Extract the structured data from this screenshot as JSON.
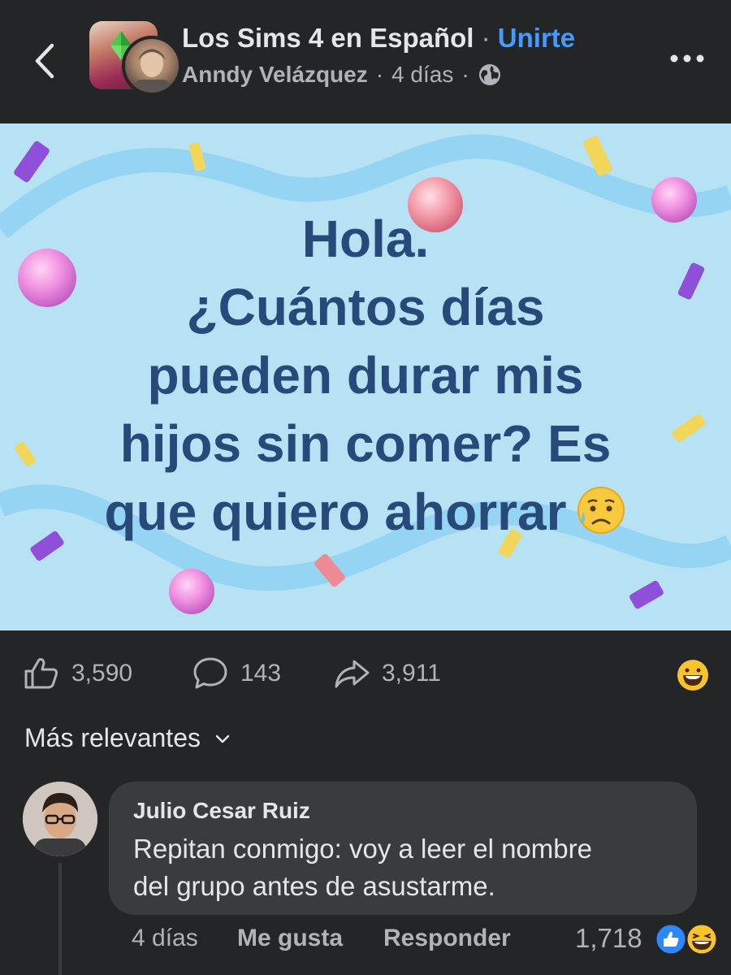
{
  "header": {
    "group_name": "Los Sims 4 en Español",
    "separator": "·",
    "join_label": "Unirte",
    "author": "Anndy Velázquez",
    "sub_separator_1": "·",
    "time": "4 días",
    "sub_separator_2": "·",
    "back_icon": "chevron-left-icon",
    "privacy_icon": "globe-icon",
    "more_icon": "more-horizontal-icon"
  },
  "post": {
    "lines": [
      "Hola.",
      "¿Cuántos días",
      "pueden durar mis",
      "hijos sin comer? Es",
      "que quiero ahorrar"
    ],
    "emoji": "sad-relieved-face-emoji",
    "background_color": "#b6e2f3",
    "text_color": "#274a7b"
  },
  "stats": {
    "likes": "3,590",
    "comments": "143",
    "shares": "3,911",
    "like_icon": "thumbs-up-icon",
    "comment_icon": "comment-bubble-icon",
    "share_icon": "share-arrow-icon",
    "reaction_emoji": "grinning-face-emoji"
  },
  "sort": {
    "label": "Más relevantes",
    "icon": "chevron-down-icon"
  },
  "comment": {
    "author": "Julio Cesar Ruiz",
    "text_line1": "Repitan conmigo: voy a leer el nombre",
    "text_line2": "del grupo antes de asustarme.",
    "time": "4 días",
    "like_label": "Me gusta",
    "reply_label": "Responder",
    "reaction_count": "1,718",
    "reaction_icons": [
      "like-reaction-icon",
      "haha-reaction-icon"
    ]
  },
  "colors": {
    "background": "#242526",
    "bubble": "#3a3b3c",
    "accent": "#4599ff",
    "secondary_text": "#b0b3b8"
  }
}
